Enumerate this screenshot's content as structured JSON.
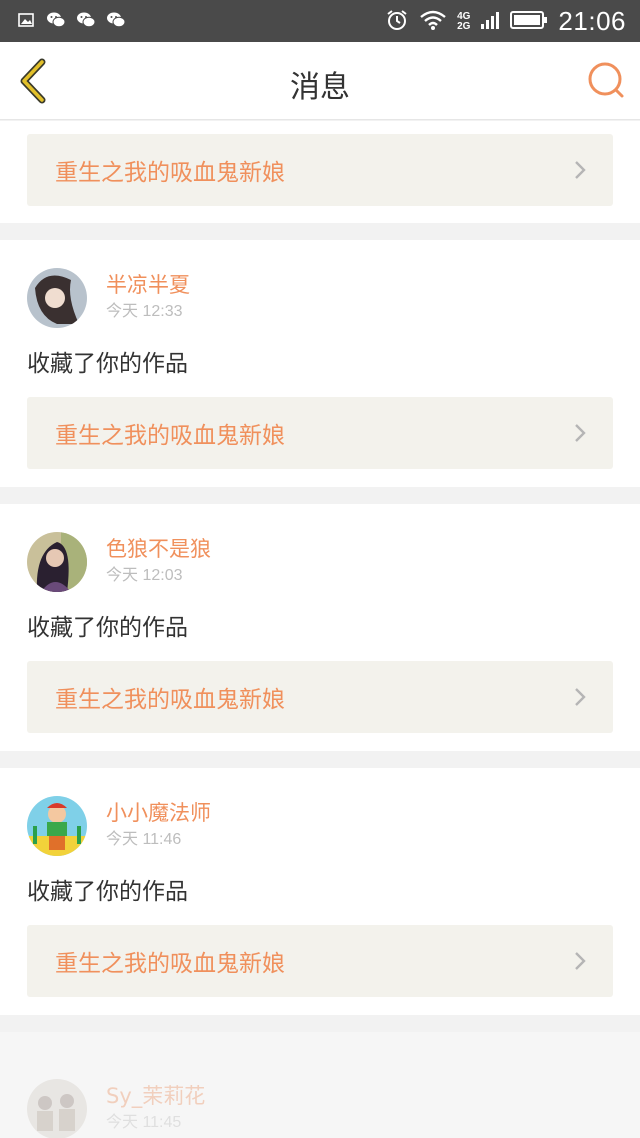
{
  "status_bar": {
    "time": "21:06",
    "network_top": "4G",
    "network_bottom": "2G",
    "icons": [
      "image-icon",
      "wechat-icon",
      "wechat-icon",
      "wechat-icon",
      "alarm-icon",
      "wifi-icon",
      "signal-icon",
      "battery-icon"
    ]
  },
  "header": {
    "title": "消息",
    "back_icon": "chevron-left-icon",
    "search_icon": "search-icon"
  },
  "colors": {
    "accent": "#f0905c",
    "back": "#d8b020",
    "work_box_bg": "#f3f2ec",
    "page_bg": "#f2f2f2"
  },
  "first_item": {
    "work_title": "重生之我的吸血鬼新娘"
  },
  "items": [
    {
      "username": "半凉半夏",
      "time": "今天 12:33",
      "action": "收藏了你的作品",
      "work_title": "重生之我的吸血鬼新娘"
    },
    {
      "username": "色狼不是狼",
      "time": "今天 12:03",
      "action": "收藏了你的作品",
      "work_title": "重生之我的吸血鬼新娘"
    },
    {
      "username": "小小魔法师",
      "time": "今天 11:46",
      "action": "收藏了你的作品",
      "work_title": "重生之我的吸血鬼新娘"
    },
    {
      "username": "Sy_茉莉花",
      "time": "今天 11:45"
    }
  ]
}
